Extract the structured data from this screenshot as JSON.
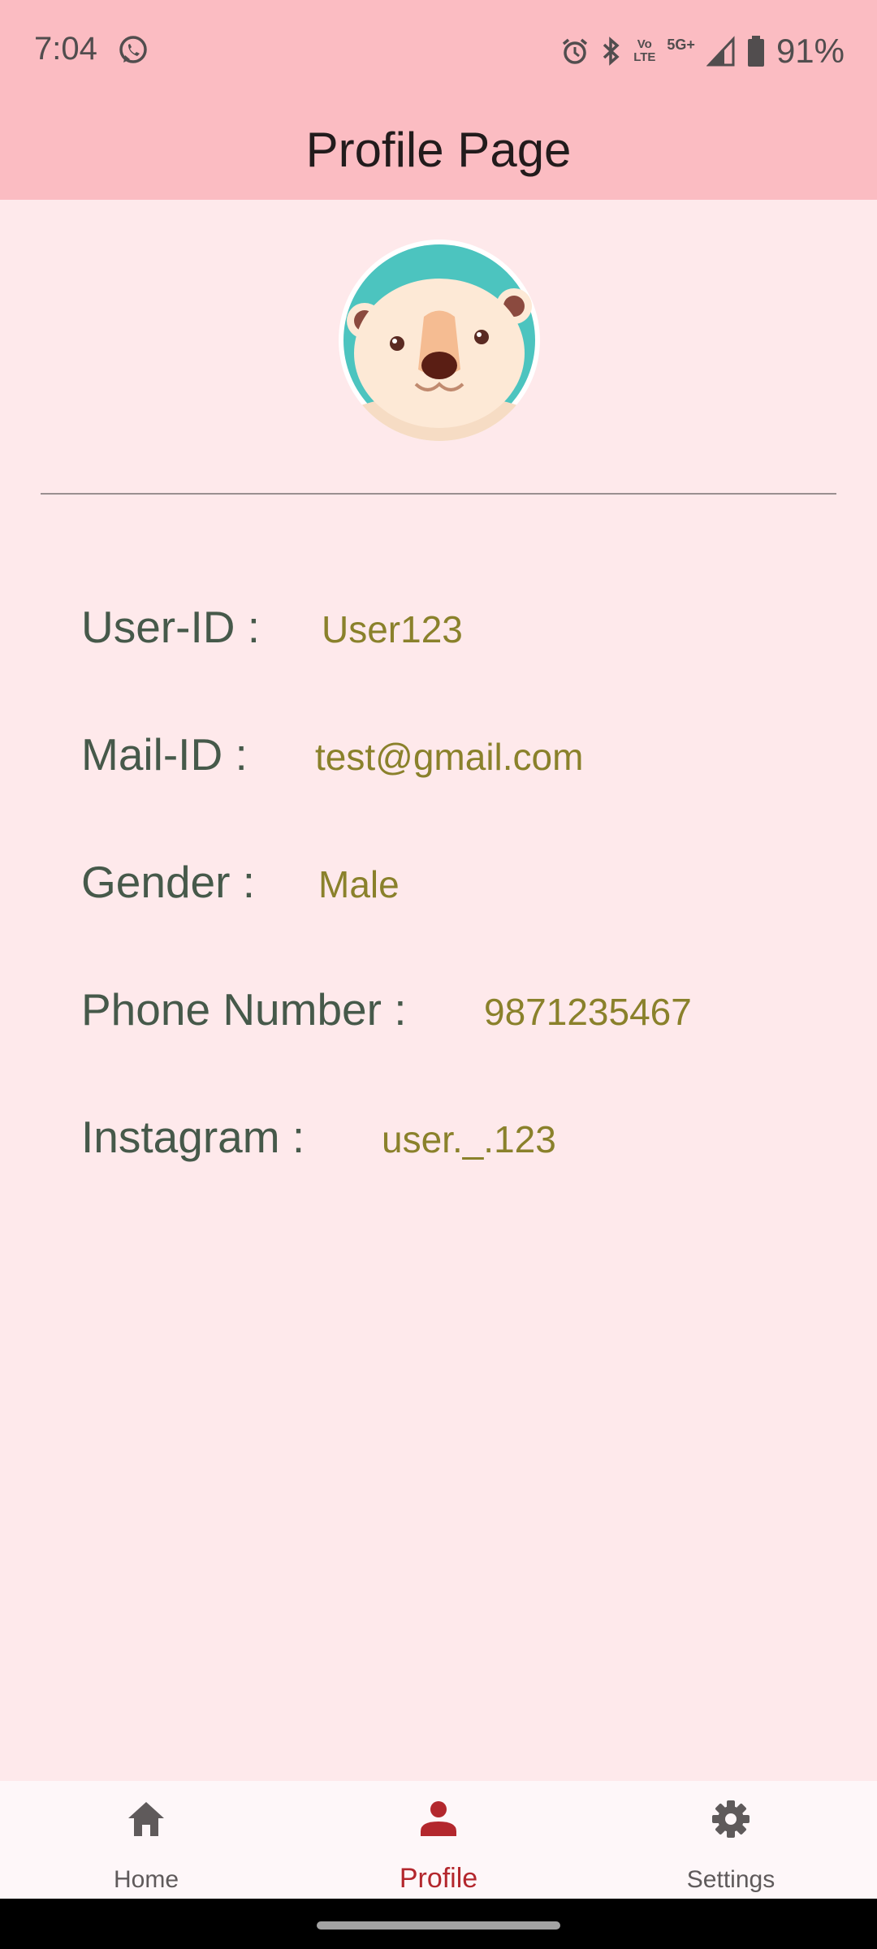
{
  "status_bar": {
    "time": "7:04",
    "network_text": "5G+",
    "volte_line1": "Vo",
    "volte_line2": "LTE",
    "battery": "91%",
    "icons": [
      "whatsapp-icon",
      "alarm-icon",
      "bluetooth-icon",
      "volte-icon",
      "signal-icon",
      "battery-icon"
    ]
  },
  "app_bar": {
    "title": "Profile Page"
  },
  "profile": {
    "avatar": "bear-avatar",
    "fields": [
      {
        "label": "User-ID :",
        "value": "User123"
      },
      {
        "label": "Mail-ID :",
        "value": "test@gmail.com"
      },
      {
        "label": "Gender :",
        "value": "Male"
      },
      {
        "label": "Phone Number :",
        "value": "9871235467"
      },
      {
        "label": "Instagram :",
        "value": "user._.123"
      }
    ]
  },
  "bottom_nav": {
    "items": [
      {
        "label": "Home",
        "icon": "home-icon",
        "active": false
      },
      {
        "label": "Profile",
        "icon": "person-icon",
        "active": true
      },
      {
        "label": "Settings",
        "icon": "gear-icon",
        "active": false
      }
    ]
  },
  "colors": {
    "app_bar": "#FBBCC2",
    "background": "#FEE9EB",
    "label_text": "#46594A",
    "value_text": "#8A812B",
    "active_nav": "#B3272D",
    "inactive_nav": "#5F5A5B"
  }
}
